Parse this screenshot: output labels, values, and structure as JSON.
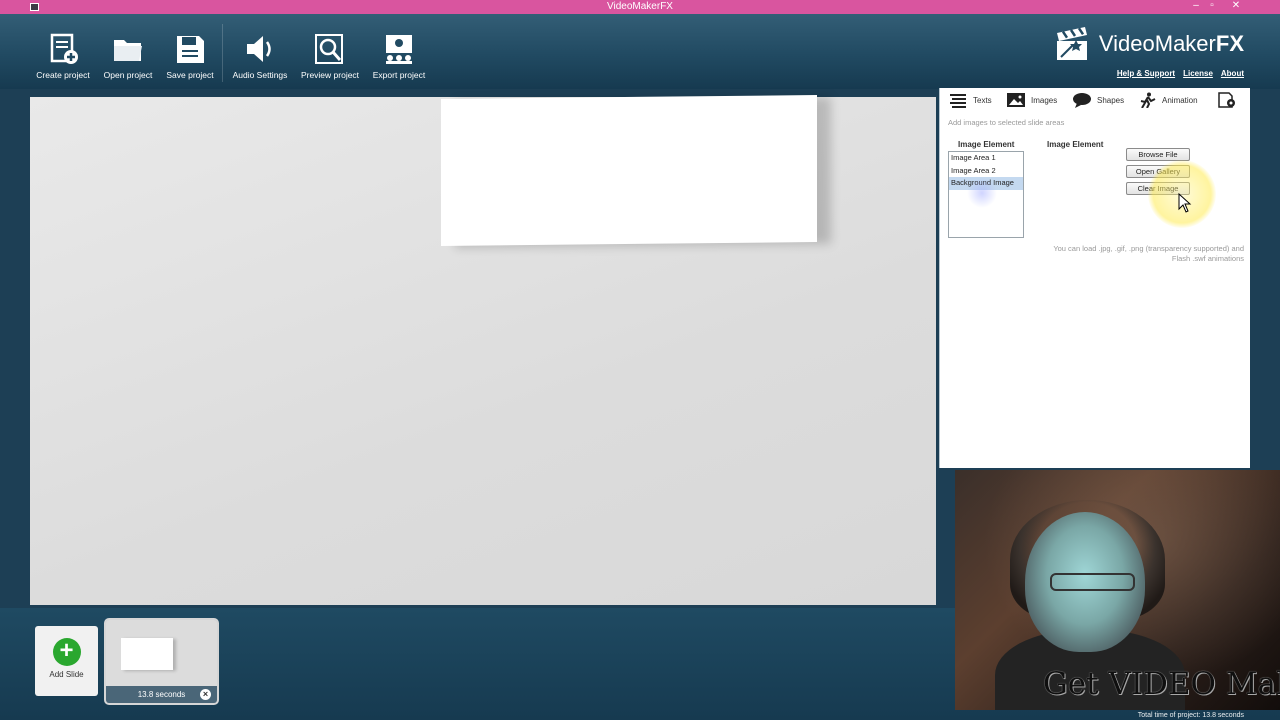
{
  "window": {
    "title": "VideoMakerFX",
    "minimize": "–",
    "maximize": "▫",
    "close": "✕"
  },
  "toolbar": {
    "items": [
      {
        "label": "Create project",
        "icon": "create-project-icon"
      },
      {
        "label": "Open project",
        "icon": "folder-icon"
      },
      {
        "label": "Save project",
        "icon": "save-icon"
      },
      {
        "label": "Audio Settings",
        "icon": "speaker-icon"
      },
      {
        "label": "Preview project",
        "icon": "magnifier-icon"
      },
      {
        "label": "Export project",
        "icon": "export-icon"
      }
    ]
  },
  "brand": {
    "name_regular": "VideoMaker",
    "name_bold": "FX",
    "links": [
      "Help & Support",
      "License",
      "About"
    ]
  },
  "panel": {
    "tabs": [
      {
        "label": "Texts",
        "icon": "texts-icon"
      },
      {
        "label": "Images",
        "icon": "images-icon"
      },
      {
        "label": "Shapes",
        "icon": "shapes-icon"
      },
      {
        "label": "Animation",
        "icon": "animation-icon"
      }
    ],
    "hint": "Add images to selected slide areas",
    "col_left": "Image Element",
    "col_right": "Image Element",
    "elements": [
      "Image Area 1",
      "Image Area 2",
      "Background Image"
    ],
    "selected_element": "Background Image",
    "buttons": {
      "browse": "Browse File",
      "gallery": "Open Gallery",
      "clear": "Clear Image"
    },
    "note_line1": "You can load .jpg, .gif, .png (transparency supported) and",
    "note_line2": "Flash .swf animations"
  },
  "slides": {
    "add_label": "Add Slide",
    "add_symbol": "+",
    "items": [
      {
        "duration": "13.8 seconds",
        "remove_symbol": "×"
      }
    ]
  },
  "webcam": {
    "overlay_text": "Get VIDEO Maker FX"
  },
  "footer": {
    "total_time": "Total time of project: 13.8 seconds"
  }
}
